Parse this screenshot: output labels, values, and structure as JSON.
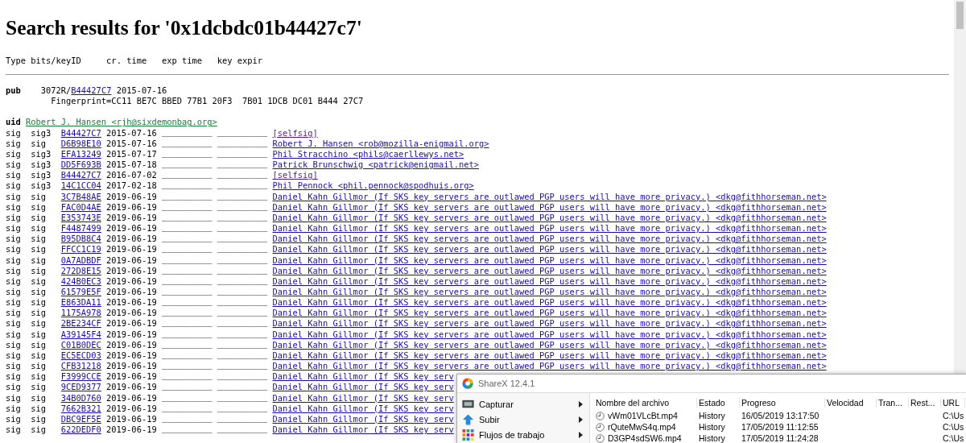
{
  "title": "Search results for '0x1dcbdc01b44427c7'",
  "header": "Type bits/keyID     cr. time   exp time   key expir",
  "pub": {
    "label": "pub",
    "bits": "3072R/",
    "key_id": "B44427C7",
    "cr_time": "2015-07-16",
    "fingerprint": "Fingerprint=CC11 BE7C BBED 77B1 20F3  7B01 1DCB DC01 B444 27C7"
  },
  "uid": {
    "label": "uid",
    "text": "Robert J. Hansen <rjh@sixdemonbag.org>"
  },
  "signatures": [
    {
      "type": "sig",
      "class": "sig3",
      "key_id": "B44427C7",
      "cr_time": "2015-07-16",
      "exp_time": "__________",
      "key_expir": "__________",
      "uid": "[selfsig]",
      "visited": true
    },
    {
      "type": "sig",
      "class": "sig",
      "key_id": "D6B98E10",
      "cr_time": "2015-07-16",
      "exp_time": "__________",
      "key_expir": "__________",
      "uid": "Robert J. Hansen <rob@mozilla-enigmail.org>",
      "visited": false
    },
    {
      "type": "sig",
      "class": "sig3",
      "key_id": "EFA13249",
      "cr_time": "2015-07-17",
      "exp_time": "__________",
      "key_expir": "__________",
      "uid": "Phil Stracchino <phils@caerllewys.net>",
      "visited": false
    },
    {
      "type": "sig",
      "class": "sig3",
      "key_id": "DD5F693B",
      "cr_time": "2015-07-18",
      "exp_time": "__________",
      "key_expir": "__________",
      "uid": "Patrick Brunschwig <patrick@enigmail.net>",
      "visited": false
    },
    {
      "type": "sig",
      "class": "sig3",
      "key_id": "B44427C7",
      "cr_time": "2016-07-02",
      "exp_time": "__________",
      "key_expir": "__________",
      "uid": "[selfsig]",
      "visited": true
    },
    {
      "type": "sig",
      "class": "sig3",
      "key_id": "14C1CC04",
      "cr_time": "2017-02-18",
      "exp_time": "__________",
      "key_expir": "__________",
      "uid": "Phil Pennock <phil.pennock@spodhuis.org>",
      "visited": false
    },
    {
      "type": "sig",
      "class": "sig",
      "key_id": "3C7B48AE",
      "cr_time": "2019-06-19",
      "exp_time": "__________",
      "key_expir": "__________",
      "uid": "Daniel Kahn Gillmor (If SKS key servers are outlawed PGP users will have more privacy.) <dkg@fithhorseman.net>",
      "visited": false
    },
    {
      "type": "sig",
      "class": "sig",
      "key_id": "FAC0D4AE",
      "cr_time": "2019-06-19",
      "exp_time": "__________",
      "key_expir": "__________",
      "uid": "Daniel Kahn Gillmor (If SKS key servers are outlawed PGP users will have more privacy.) <dkg@fithhorseman.net>",
      "visited": false
    },
    {
      "type": "sig",
      "class": "sig",
      "key_id": "E353743E",
      "cr_time": "2019-06-19",
      "exp_time": "__________",
      "key_expir": "__________",
      "uid": "Daniel Kahn Gillmor (If SKS key servers are outlawed PGP users will have more privacy.) <dkg@fithhorseman.net>",
      "visited": false
    },
    {
      "type": "sig",
      "class": "sig",
      "key_id": "F4487499",
      "cr_time": "2019-06-19",
      "exp_time": "__________",
      "key_expir": "__________",
      "uid": "Daniel Kahn Gillmor (If SKS key servers are outlawed PGP users will have more privacy.) <dkg@fithhorseman.net>",
      "visited": false
    },
    {
      "type": "sig",
      "class": "sig",
      "key_id": "B95DB8C4",
      "cr_time": "2019-06-19",
      "exp_time": "__________",
      "key_expir": "__________",
      "uid": "Daniel Kahn Gillmor (If SKS key servers are outlawed PGP users will have more privacy.) <dkg@fithhorseman.net>",
      "visited": false
    },
    {
      "type": "sig",
      "class": "sig",
      "key_id": "FFCC1C19",
      "cr_time": "2019-06-19",
      "exp_time": "__________",
      "key_expir": "__________",
      "uid": "Daniel Kahn Gillmor (If SKS key servers are outlawed PGP users will have more privacy.) <dkg@fithhorseman.net>",
      "visited": false
    },
    {
      "type": "sig",
      "class": "sig",
      "key_id": "0A7ADBDF",
      "cr_time": "2019-06-19",
      "exp_time": "__________",
      "key_expir": "__________",
      "uid": "Daniel Kahn Gillmor (If SKS key servers are outlawed PGP users will have more privacy.) <dkg@fithhorseman.net>",
      "visited": false
    },
    {
      "type": "sig",
      "class": "sig",
      "key_id": "272D8E15",
      "cr_time": "2019-06-19",
      "exp_time": "__________",
      "key_expir": "__________",
      "uid": "Daniel Kahn Gillmor (If SKS key servers are outlawed PGP users will have more privacy.) <dkg@fithhorseman.net>",
      "visited": false
    },
    {
      "type": "sig",
      "class": "sig",
      "key_id": "424B0EC3",
      "cr_time": "2019-06-19",
      "exp_time": "__________",
      "key_expir": "__________",
      "uid": "Daniel Kahn Gillmor (If SKS key servers are outlawed PGP users will have more privacy.) <dkg@fithhorseman.net>",
      "visited": false
    },
    {
      "type": "sig",
      "class": "sig",
      "key_id": "61579E5F",
      "cr_time": "2019-06-19",
      "exp_time": "__________",
      "key_expir": "__________",
      "uid": "Daniel Kahn Gillmor (If SKS key servers are outlawed PGP users will have more privacy.) <dkg@fithhorseman.net>",
      "visited": false
    },
    {
      "type": "sig",
      "class": "sig",
      "key_id": "E863DA11",
      "cr_time": "2019-06-19",
      "exp_time": "__________",
      "key_expir": "__________",
      "uid": "Daniel Kahn Gillmor (If SKS key servers are outlawed PGP users will have more privacy.) <dkg@fithhorseman.net>",
      "visited": false
    },
    {
      "type": "sig",
      "class": "sig",
      "key_id": "1175A978",
      "cr_time": "2019-06-19",
      "exp_time": "__________",
      "key_expir": "__________",
      "uid": "Daniel Kahn Gillmor (If SKS key servers are outlawed PGP users will have more privacy.) <dkg@fithhorseman.net>",
      "visited": false
    },
    {
      "type": "sig",
      "class": "sig",
      "key_id": "2BE234CF",
      "cr_time": "2019-06-19",
      "exp_time": "__________",
      "key_expir": "__________",
      "uid": "Daniel Kahn Gillmor (If SKS key servers are outlawed PGP users will have more privacy.) <dkg@fithhorseman.net>",
      "visited": false
    },
    {
      "type": "sig",
      "class": "sig",
      "key_id": "A39145F4",
      "cr_time": "2019-06-19",
      "exp_time": "__________",
      "key_expir": "__________",
      "uid": "Daniel Kahn Gillmor (If SKS key servers are outlawed PGP users will have more privacy.) <dkg@fithhorseman.net>",
      "visited": false
    },
    {
      "type": "sig",
      "class": "sig",
      "key_id": "C01B0DEC",
      "cr_time": "2019-06-19",
      "exp_time": "__________",
      "key_expir": "__________",
      "uid": "Daniel Kahn Gillmor (If SKS key servers are outlawed PGP users will have more privacy.) <dkg@fithhorseman.net>",
      "visited": false
    },
    {
      "type": "sig",
      "class": "sig",
      "key_id": "EC5ECD03",
      "cr_time": "2019-06-19",
      "exp_time": "__________",
      "key_expir": "__________",
      "uid": "Daniel Kahn Gillmor (If SKS key servers are outlawed PGP users will have more privacy.) <dkg@fithhorseman.net>",
      "visited": false
    },
    {
      "type": "sig",
      "class": "sig",
      "key_id": "CFB31218",
      "cr_time": "2019-06-19",
      "exp_time": "__________",
      "key_expir": "__________",
      "uid": "Daniel Kahn Gillmor (If SKS key servers are outlawed PGP users will have more privacy.) <dkg@fithhorseman.net>",
      "visited": false
    },
    {
      "type": "sig",
      "class": "sig",
      "key_id": "F3999CCE",
      "cr_time": "2019-06-19",
      "exp_time": "__________",
      "key_expir": "__________",
      "uid": "Daniel Kahn Gillmor (If SKS key serv",
      "visited": false
    },
    {
      "type": "sig",
      "class": "sig",
      "key_id": "9CED9377",
      "cr_time": "2019-06-19",
      "exp_time": "__________",
      "key_expir": "__________",
      "uid": "Daniel Kahn Gillmor (If SKS key serv",
      "visited": false
    },
    {
      "type": "sig",
      "class": "sig",
      "key_id": "34B0D760",
      "cr_time": "2019-06-19",
      "exp_time": "__________",
      "key_expir": "__________",
      "uid": "Daniel Kahn Gillmor (If SKS key serv",
      "visited": false
    },
    {
      "type": "sig",
      "class": "sig",
      "key_id": "7662B321",
      "cr_time": "2019-06-19",
      "exp_time": "__________",
      "key_expir": "__________",
      "uid": "Daniel Kahn Gillmor (If SKS key serv",
      "visited": false
    },
    {
      "type": "sig",
      "class": "sig",
      "key_id": "DBC9EF5E",
      "cr_time": "2019-06-19",
      "exp_time": "__________",
      "key_expir": "__________",
      "uid": "Daniel Kahn Gillmor (If SKS key serv",
      "visited": false
    },
    {
      "type": "sig",
      "class": "sig",
      "key_id": "622DEDF0",
      "cr_time": "2019-06-19",
      "exp_time": "__________",
      "key_expir": "__________",
      "uid": "Daniel Kahn Gillmor (If SKS key serv",
      "visited": false
    }
  ],
  "sharex": {
    "title": "ShareX 12.4.1",
    "menu": [
      {
        "label": "Capturar",
        "kind": "capture"
      },
      {
        "label": "Subir",
        "kind": "upload"
      },
      {
        "label": "Flujos de trabajo",
        "kind": "workflows"
      }
    ],
    "columns": [
      "Nombre del archivo",
      "Estado",
      "Progreso",
      "Velocidad",
      "Tran...",
      "Rest...",
      "URL"
    ],
    "files": [
      {
        "name": "vWm01VLcBt.mp4",
        "status": "History",
        "progress": "16/05/2019 13:17:50",
        "url": "C:\\Us"
      },
      {
        "name": "rQuteMwS4q.mp4",
        "status": "History",
        "progress": "17/05/2019 11:12:55",
        "url": "C:\\Us"
      },
      {
        "name": "D3GP4sdSW6.mp4",
        "status": "History",
        "progress": "17/05/2019 11:24:28",
        "url": "C:\\Us"
      }
    ]
  }
}
